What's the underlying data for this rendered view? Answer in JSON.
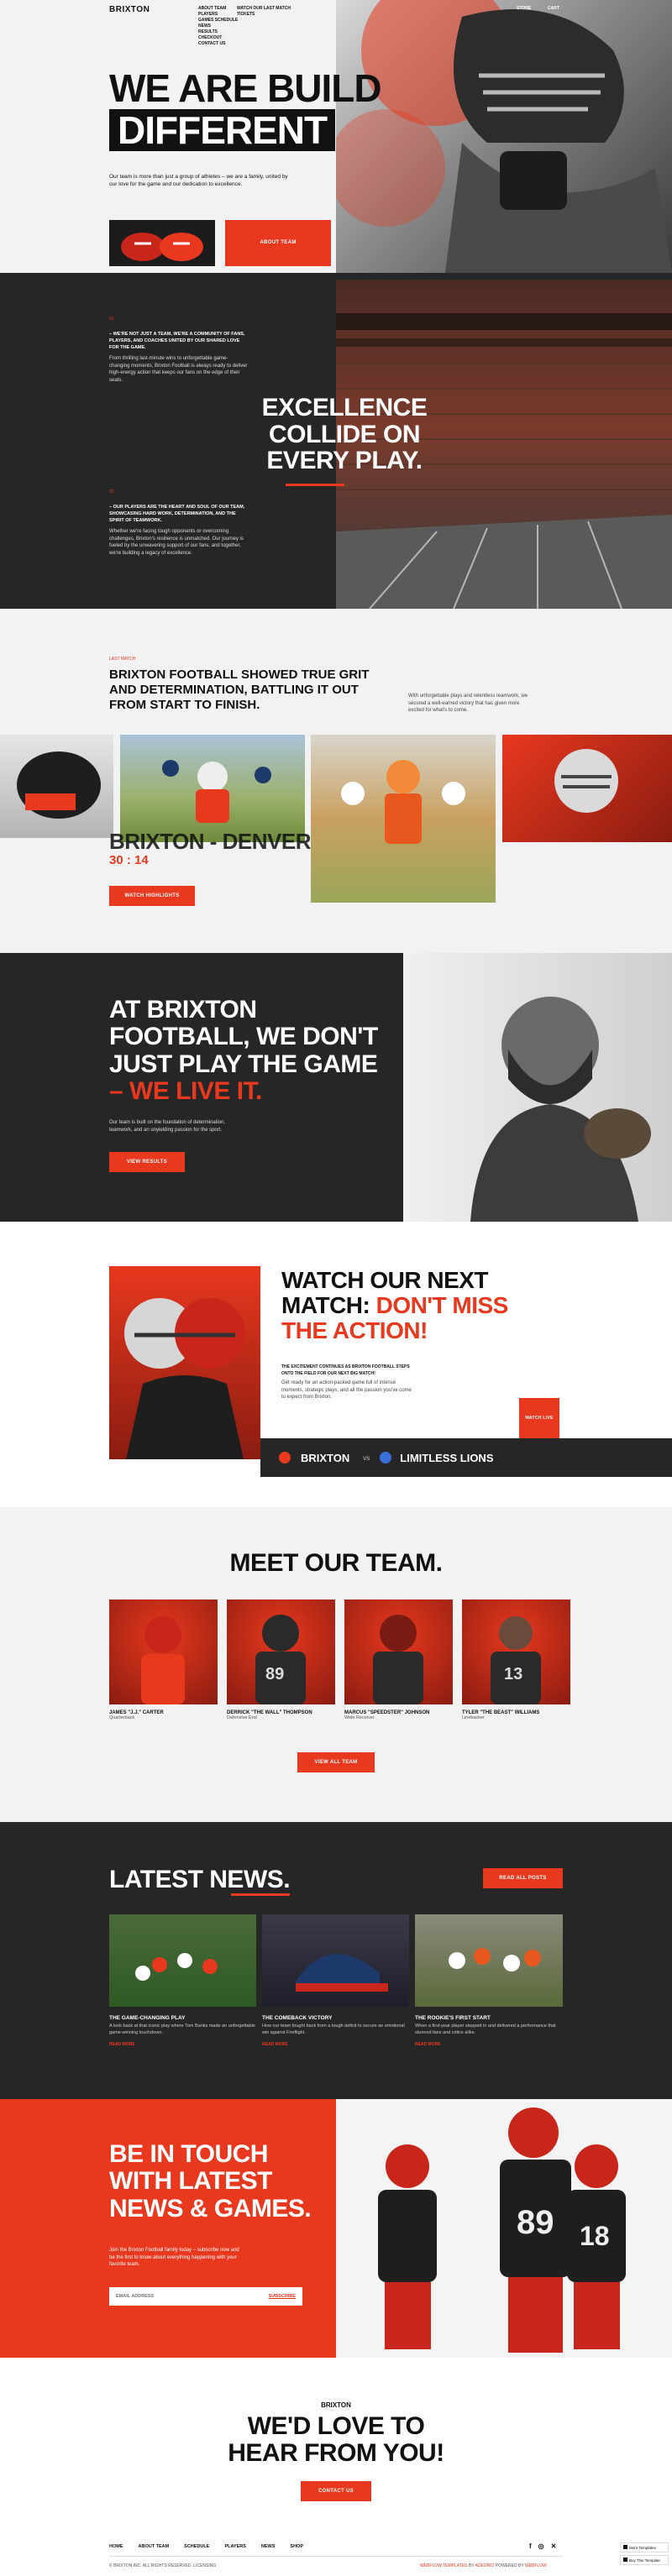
{
  "brand": "BRIXTON",
  "nav": {
    "col1": [
      "ABOUT TEAM",
      "PLAYERS",
      "GAMES SCHEDULE",
      "NEWS",
      "RESULTS",
      "CHECKOUT",
      "CONTACT US"
    ],
    "col2": [
      "WATCH OUR LAST MATCH",
      "TICKETS"
    ],
    "right": [
      "STORE",
      "CART"
    ]
  },
  "hero": {
    "line1": "WE ARE BUILD",
    "line2": "DIFFERENT",
    "text": "Our team is more than just a group of athletes – we are a family, united by our love for the game and our dedication to excellence.",
    "button": "ABOUT TEAM"
  },
  "excellence": {
    "num1": "01",
    "lead1": "– WE'RE NOT JUST A TEAM, WE'RE A COMMUNITY OF FANS, PLAYERS, AND COACHES UNITED BY OUR SHARED LOVE FOR THE GAME.",
    "text1": "From thrilling last-minute wins to unforgettable game-changing moments, Brixton Football is always ready to deliver high-energy action that keeps our fans on the edge of their seats.",
    "num2": "02",
    "lead2": "– OUR PLAYERS ARE THE HEART AND SOUL OF OUR TEAM, SHOWCASING HARD WORK, DETERMINATION, AND THE SPIRIT OF TEAMWORK.",
    "text2": "Whether we're facing tough opponents or overcoming challenges, Brixton's resilience is unmatched. Our journey is fueled by the unwavering support of our fans, and together, we're building a legacy of excellence.",
    "overlay": [
      "EXCELLENCE",
      "COLLIDE ON",
      "EVERY PLAY."
    ]
  },
  "lastmatch": {
    "label": "LAST MATCH",
    "headline": "BRIXTON FOOTBALL SHOWED TRUE GRIT AND DETERMINATION, BATTLING IT OUT FROM START TO FINISH.",
    "aside": "With unforgettable plays and relentless teamwork, we secured a well-earned victory that has given more excited for what's to come.",
    "matchup": "BRIXTON - DENVER",
    "score": "30 : 14",
    "button": "WATCH HIGHLIGHTS"
  },
  "liveit": {
    "line1": "AT BRIXTON",
    "line2": "FOOTBALL, WE DON'T",
    "line3": "JUST PLAY THE GAME",
    "line4": "– WE LIVE IT.",
    "text": "Our team is built on the foundation of determination, teamwork, and an unyielding passion for the sport.",
    "button": "VIEW RESULTS"
  },
  "nextmatch": {
    "line1": "WATCH OUR NEXT",
    "line2": "MATCH: ",
    "line2b": "DON'T MISS",
    "line3": "THE ACTION!",
    "lead": "THE EXCITEMENT CONTINUES AS BRIXTON FOOTBALL STEPS ONTO THE FIELD FOR OUR NEXT BIG MATCH!",
    "text": "Get ready for an action-packed game full of intense moments, strategic plays, and all the passion you've come to expect from Brixton.",
    "button": "WATCH LIVE",
    "home": "BRIXTON",
    "vs": "vs",
    "away": "LIMITLESS LIONS"
  },
  "team": {
    "title": "MEET OUR TEAM.",
    "members": [
      {
        "name": "JAMES \"J.J.\" CARTER",
        "role": "Quarterback",
        "number": ""
      },
      {
        "name": "DERRICK \"THE WALL\" THOMPSON",
        "role": "Defensive End",
        "number": "89"
      },
      {
        "name": "MARCUS \"SPEEDSTER\" JOHNSON",
        "role": "Wide Receiver",
        "number": ""
      },
      {
        "name": "TYLER \"THE BEAST\" WILLIAMS",
        "role": "Linebacker",
        "number": "13"
      }
    ],
    "button": "VIEW ALL TEAM"
  },
  "news": {
    "title": "LATEST NEWS.",
    "button": "READ ALL POSTS",
    "items": [
      {
        "title": "THE GAME-CHANGING PLAY",
        "text": "A look back at that iconic play where Tom Banks made an unforgettable game-winning touchdown.",
        "link": "READ MORE"
      },
      {
        "title": "THE COMEBACK VICTORY",
        "text": "How our team fought back from a tough deficit to secure an emotional win against Fireflight.",
        "link": "READ MORE"
      },
      {
        "title": "THE ROOKIE'S FIRST START",
        "text": "When a first-year player stepped in and delivered a performance that stunned fans and critics alike.",
        "link": "READ MORE"
      }
    ]
  },
  "touch": {
    "line1": "BE IN TOUCH",
    "line2": "WITH LATEST",
    "line3": "NEWS & GAMES.",
    "text": "Join the Brixton Football family today – subscribe now and be the first to know about everything happening with your favorite team.",
    "placeholder": "EMAIL ADDRESS",
    "button": "SUBSCRIBE",
    "jersey1": "89",
    "jersey2": "18"
  },
  "contact": {
    "brand": "BRIXTON",
    "line1": "WE'D LOVE TO",
    "line2": "HEAR FROM YOU!",
    "button": "CONTACT US"
  },
  "footer": {
    "links": [
      "HOME",
      "ABOUT TEAM",
      "SCHEDULE",
      "PLAYERS",
      "NEWS",
      "SHOP"
    ],
    "copyright": "© BRIXTON INC. ALL RIGHTS RESERVED. LICENSING",
    "credit_a": "WEBFLOW TEMPLATES",
    "credit_b": "BY",
    "credit_c": "ADEURIO",
    "credit_d": "POWERED BY",
    "credit_e": "WEBFLOW",
    "badge1": "More Templates",
    "badge2": "Buy This Template"
  },
  "colors": {
    "accent": "#e8381e",
    "dark": "#262626"
  }
}
